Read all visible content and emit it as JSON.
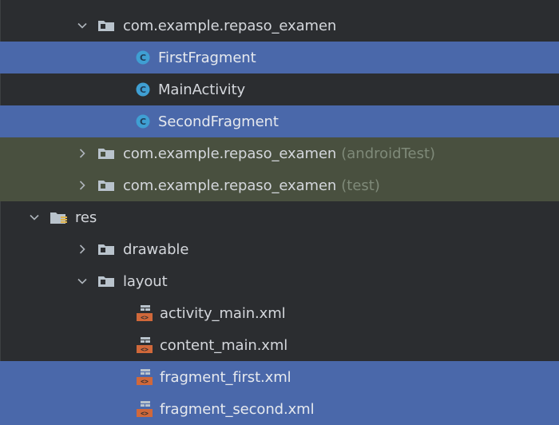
{
  "tree": {
    "package_main": {
      "label": "com.example.repaso_examen"
    },
    "class_first": {
      "label": "FirstFragment"
    },
    "class_main": {
      "label": "MainActivity"
    },
    "class_second": {
      "label": "SecondFragment"
    },
    "package_android_test": {
      "label": "com.example.repaso_examen",
      "suffix": "(androidTest)"
    },
    "package_test": {
      "label": "com.example.repaso_examen",
      "suffix": "(test)"
    },
    "res": {
      "label": "res"
    },
    "drawable": {
      "label": "drawable"
    },
    "layout": {
      "label": "layout"
    },
    "xml_activity_main": {
      "label": "activity_main.xml"
    },
    "xml_content_main": {
      "label": "content_main.xml"
    },
    "xml_fragment_first": {
      "label": "fragment_first.xml"
    },
    "xml_fragment_second": {
      "label": "fragment_second.xml"
    }
  },
  "colors": {
    "background": "#2b2d30",
    "selection": "#4a68aa",
    "test_scope": "#49503f",
    "class_icon": "#3f9fd3",
    "xml_icon": "#d0683a",
    "folder_icon": "#b9c3cc"
  },
  "icons": {
    "expanded": "chevron-down-icon",
    "collapsed": "chevron-right-icon",
    "package": "folder-icon",
    "resource_root": "resource-folder-icon",
    "class": "class-icon",
    "layout_file": "layout-xml-icon"
  }
}
